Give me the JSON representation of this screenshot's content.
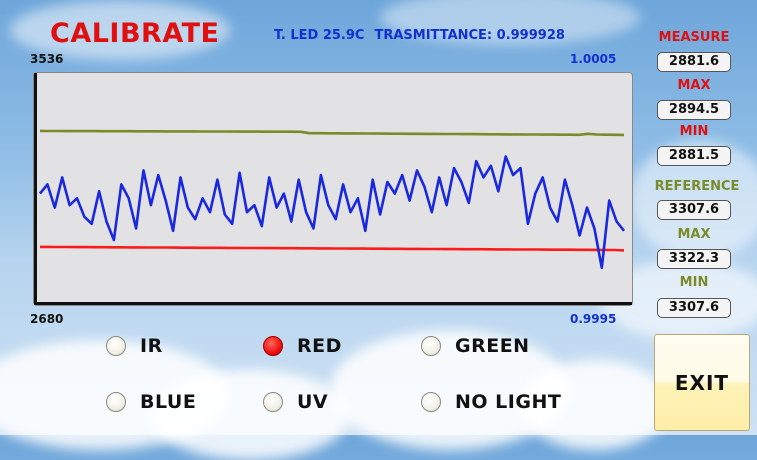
{
  "header": {
    "title": "CALIBRATE",
    "led_temp": "T. LED 25.9C",
    "transmittance": "TRASMITTANCE: 0.999928"
  },
  "chart_axis": {
    "left_max": "3536",
    "left_min": "2680",
    "right_max": "1.0005",
    "right_min": "0.9995"
  },
  "sidebar": {
    "measure_label": "MEASURE",
    "measure_value": "2881.6",
    "measure_max_label": "MAX",
    "measure_max_value": "2894.5",
    "measure_min_label": "MIN",
    "measure_min_value": "2881.5",
    "reference_label": "REFERENCE",
    "reference_value": "3307.6",
    "reference_max_label": "MAX",
    "reference_max_value": "3322.3",
    "reference_min_label": "MIN",
    "reference_min_value": "3307.6"
  },
  "light_options": [
    {
      "label": "IR",
      "selected": false
    },
    {
      "label": "RED",
      "selected": true
    },
    {
      "label": "GREEN",
      "selected": false
    },
    {
      "label": "BLUE",
      "selected": false
    },
    {
      "label": "UV",
      "selected": false
    },
    {
      "label": "NO LIGHT",
      "selected": false
    }
  ],
  "exit_label": "EXIT",
  "colors": {
    "title": "#e01010",
    "info": "#1030d0",
    "reference_series": "#7a8b2a",
    "measure_series": "#ff1a1a",
    "transmittance_series": "#1a28e0",
    "selected_radio": "#ee1010"
  },
  "chart_data": {
    "type": "line",
    "ylim_left": [
      2680,
      3536
    ],
    "ylim_right": [
      0.9995,
      1.0005
    ],
    "series": [
      {
        "axis": "left",
        "color": "#7a8b2a",
        "values": [
          3322.3,
          3322.1,
          3321.9,
          3321.8,
          3321.7,
          3321.6,
          3321.5,
          3321.4,
          3321.3,
          3321.2,
          3321.1,
          3321.0,
          3320.9,
          3320.8,
          3320.7,
          3320.6,
          3320.5,
          3320.4,
          3320.3,
          3320.2,
          3320.1,
          3320.0,
          3319.9,
          3319.8,
          3319.7,
          3319.6,
          3319.5,
          3319.4,
          3319.3,
          3319.2,
          3314.0,
          3313.8,
          3313.6,
          3313.4,
          3313.2,
          3313.0,
          3312.8,
          3312.6,
          3312.4,
          3312.2,
          3312.0,
          3311.8,
          3311.6,
          3311.4,
          3311.2,
          3311.0,
          3310.8,
          3310.6,
          3310.4,
          3310.2,
          3310.0,
          3309.8,
          3309.6,
          3309.4,
          3309.2,
          3309.0,
          3308.8,
          3308.6,
          3308.4,
          3308.2,
          3308.0,
          3311.5,
          3309.0,
          3308.4,
          3307.9,
          3307.6
        ]
      },
      {
        "axis": "left",
        "color": "#ff1a1a",
        "values": [
          2894.5,
          2894.3,
          2894.1,
          2893.9,
          2893.8,
          2893.6,
          2893.4,
          2893.2,
          2893.0,
          2892.9,
          2892.7,
          2892.5,
          2892.3,
          2892.1,
          2892.0,
          2891.8,
          2891.6,
          2891.4,
          2891.2,
          2891.1,
          2890.9,
          2890.7,
          2890.5,
          2890.3,
          2890.2,
          2890.0,
          2889.8,
          2889.6,
          2889.4,
          2889.3,
          2889.1,
          2888.9,
          2888.7,
          2888.5,
          2888.4,
          2888.2,
          2888.0,
          2887.8,
          2887.6,
          2887.5,
          2887.3,
          2887.1,
          2886.9,
          2886.7,
          2886.6,
          2886.4,
          2886.2,
          2886.0,
          2885.8,
          2885.7,
          2885.5,
          2885.3,
          2885.1,
          2884.9,
          2884.8,
          2884.6,
          2884.4,
          2884.2,
          2884.0,
          2883.9,
          2883.7,
          2883.5,
          2883.3,
          2883.1,
          2882.9,
          2881.6
        ]
      },
      {
        "axis": "right",
        "color": "#1a28e0",
        "values": [
          0.99998,
          1.00002,
          0.99992,
          1.00005,
          0.99993,
          0.99996,
          0.99988,
          0.99985,
          0.99999,
          0.99986,
          0.99978,
          1.00002,
          0.99996,
          0.99983,
          1.00008,
          0.99993,
          1.00006,
          0.99995,
          0.99982,
          1.00005,
          0.99992,
          0.99987,
          0.99996,
          0.9999,
          1.00004,
          0.99989,
          0.99985,
          1.00007,
          0.9999,
          0.99993,
          0.99984,
          1.00005,
          0.99992,
          0.99998,
          0.99986,
          1.00004,
          0.9999,
          0.99983,
          1.00006,
          0.99993,
          0.99987,
          1.00002,
          0.9999,
          0.99996,
          0.99982,
          1.00004,
          0.99989,
          1.00003,
          0.99998,
          1.00006,
          0.99995,
          1.00008,
          1.00001,
          0.9999,
          1.00005,
          0.99993,
          1.00009,
          1.00003,
          0.99994,
          1.00012,
          1.00005,
          1.0001,
          0.99999,
          1.00014,
          1.00006,
          1.00009,
          0.99985,
          0.99998,
          1.00005,
          0.99992,
          0.99986,
          1.00004,
          0.99993,
          0.9998,
          0.99992,
          0.99983,
          0.99966,
          0.99995,
          0.99986,
          0.99982
        ]
      }
    ]
  }
}
